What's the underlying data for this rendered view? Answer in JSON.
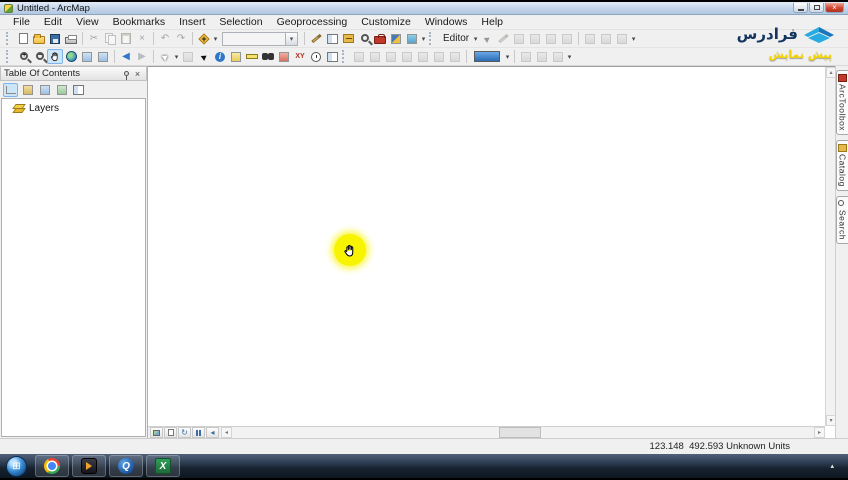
{
  "window": {
    "title": "Untitled - ArcMap"
  },
  "menu_bar": {
    "items": [
      "File",
      "Edit",
      "View",
      "Bookmarks",
      "Insert",
      "Selection",
      "Geoprocessing",
      "Customize",
      "Windows",
      "Help"
    ]
  },
  "standard_toolbar": {
    "scale_value": ""
  },
  "editor_toolbar": {
    "label": "Editor"
  },
  "toc_panel": {
    "title": "Table Of Contents",
    "root_item": "Layers"
  },
  "dock_tabs": [
    {
      "label": "ArcToolbox"
    },
    {
      "label": "Catalog"
    },
    {
      "label": "Search"
    }
  ],
  "status_bar": {
    "coordinates": "123.148  492.593 Unknown Units"
  },
  "watermark": {
    "brand": "فرادرس",
    "preview_badge": "پیش نمایش"
  },
  "taskbar": {
    "apps": [
      {
        "name": "start"
      },
      {
        "name": "chrome"
      },
      {
        "name": "media-player"
      },
      {
        "name": "q-player",
        "letter": "Q"
      },
      {
        "name": "excel",
        "letter": "X"
      }
    ]
  },
  "glyphs": {
    "dropdown": "▾",
    "cut": "✂",
    "delete": "×",
    "undo": "↶",
    "redo": "↷",
    "back": "◀",
    "forward": "▶",
    "plus": "+",
    "minus": "−",
    "up": "▴",
    "down": "▾",
    "left": "◂",
    "right": "▸",
    "refresh": "↻",
    "close": "×",
    "identify": "i",
    "start": "⊞",
    "xy": "XY",
    "tray": "▴"
  },
  "colors": {
    "highlight_yellow": "#f8f400",
    "titlebar_blue": "#bfd2e8",
    "accent_blue": "#2b6cb5",
    "toolbox_red": "#c0392b"
  }
}
